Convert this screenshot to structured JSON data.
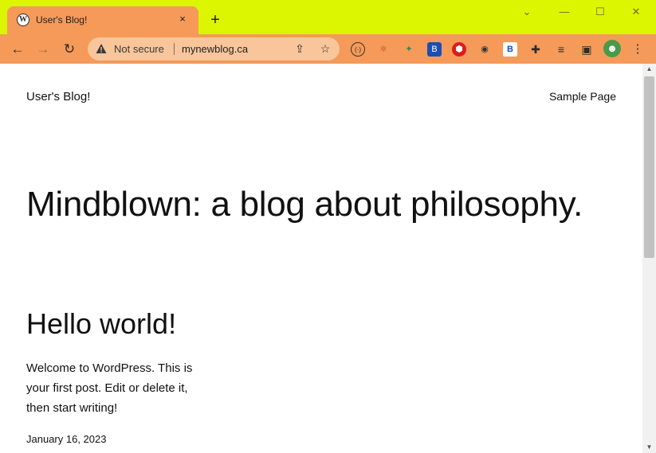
{
  "browser": {
    "tab": {
      "title": "User's Blog!",
      "favicon": "wordpress-icon",
      "close_icon": "×"
    },
    "new_tab_icon": "+",
    "window_controls": {
      "chevron": "⌄",
      "minimize": "—",
      "maximize": "☐",
      "close": "✕"
    },
    "nav": {
      "back": "←",
      "forward": "→",
      "reload": "↻"
    },
    "omnibox": {
      "security_label": "Not secure",
      "url": "mynewblog.ca",
      "share_icon": "⇪",
      "star_icon": "☆"
    },
    "extensions": [
      "(·)",
      "⚛",
      "✦",
      "B",
      "⬢",
      "◉",
      "B",
      "✚",
      "≡",
      "▣",
      "☻",
      "⋮"
    ]
  },
  "site": {
    "title": "User's Blog!",
    "nav_link": "Sample Page",
    "hero": "Mindblown: a blog about philosophy."
  },
  "post": {
    "title": "Hello world!",
    "excerpt": "Welcome to WordPress. This is your first post. Edit or delete it, then start writing!",
    "date": "January 16, 2023"
  },
  "scrollbar": {
    "up": "▲",
    "down": "▼"
  },
  "colors": {
    "titlebar": "#dcf500",
    "toolbar": "#f59a59",
    "omnibox": "#f8c69a"
  }
}
